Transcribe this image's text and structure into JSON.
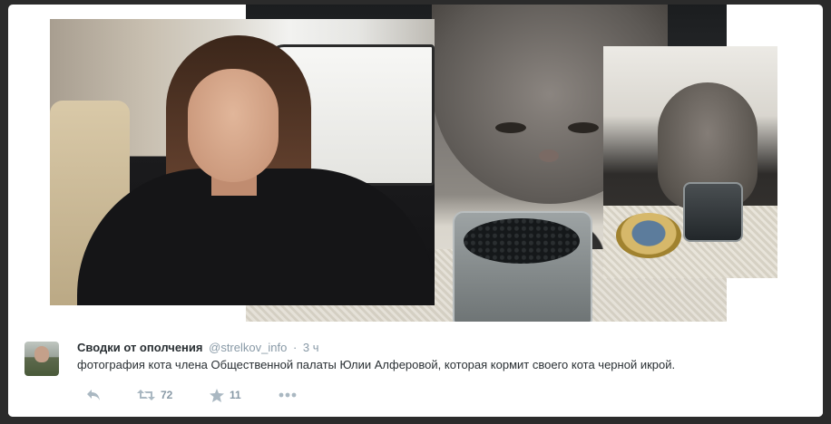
{
  "tweet": {
    "user_name": "Сводки от ополчения",
    "handle": "@strelkov_info",
    "separator": "·",
    "time": "3 ч",
    "text": "фотография кота члена Общественной палаты Юлии Алферовой, которая кормит своего кота черной икрой.",
    "actions": {
      "reply_icon": "reply-icon",
      "retweet_icon": "retweet-icon",
      "retweet_count": "72",
      "favorite_icon": "star-icon",
      "favorite_count": "11",
      "more_icon": "more-icon"
    }
  },
  "colors": {
    "background": "#2b2b2b",
    "card": "#ffffff",
    "name": "#292f33",
    "muted": "#8899a6",
    "icon": "#aab8c2"
  }
}
